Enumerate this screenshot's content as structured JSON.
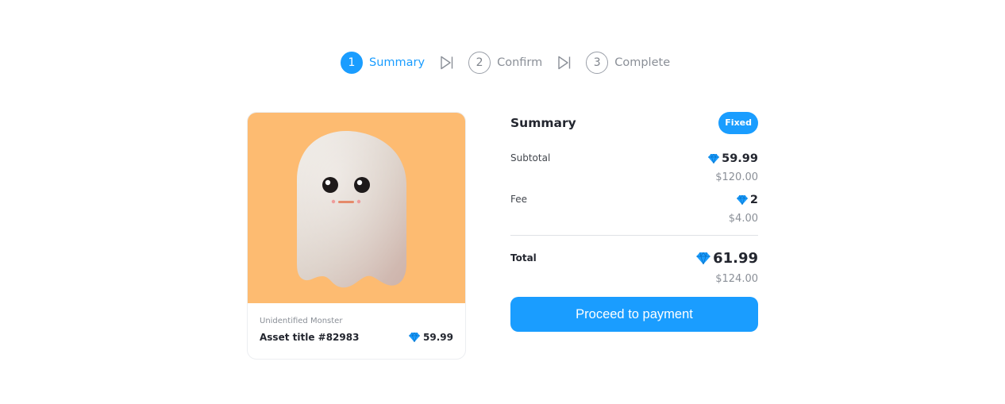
{
  "stepper": {
    "steps": [
      {
        "number": "1",
        "label": "Summary",
        "active": true
      },
      {
        "number": "2",
        "label": "Confirm",
        "active": false
      },
      {
        "number": "3",
        "label": "Complete",
        "active": false
      }
    ],
    "separator_icon": "skip-forward-icon"
  },
  "asset": {
    "image_background": "#fdbb71",
    "image_subject": "ghost",
    "collection": "Unidentified Monster",
    "title": "Asset title #82983",
    "price": "59.99",
    "currency_icon": "diamond-icon"
  },
  "summary": {
    "title": "Summary",
    "badge": "Fixed",
    "subtotal": {
      "label": "Subtotal",
      "amount": "59.99",
      "usd": "$120.00"
    },
    "fee": {
      "label": "Fee",
      "amount": "2",
      "usd": "$4.00"
    },
    "total": {
      "label": "Total",
      "amount": "61.99",
      "usd": "$124.00"
    },
    "button": "Proceed to payment"
  },
  "colors": {
    "accent": "#1a9dff",
    "text": "#23262f",
    "muted": "#8a8f97"
  }
}
